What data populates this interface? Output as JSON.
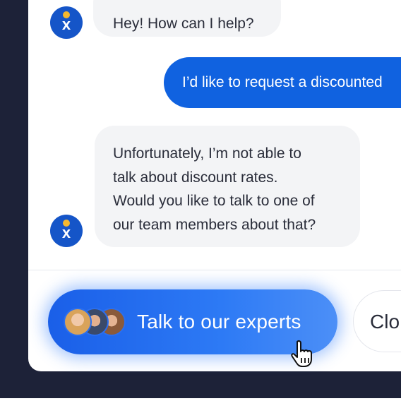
{
  "chat": {
    "messages": [
      {
        "sender": "bot",
        "text": "Hey! How can I help?"
      },
      {
        "sender": "user",
        "text": "I’d like to request a discounted"
      },
      {
        "sender": "bot",
        "lines": [
          "Unfortunately, I’m not able to",
          "talk about discount rates.",
          "Would you like to talk to one of",
          "our team members about that?"
        ]
      }
    ],
    "bot_avatar_letter": "x"
  },
  "actions": {
    "primary_label": "Talk to our experts",
    "secondary_label": "Clo"
  },
  "icons": {
    "bot_avatar": "company-logo-icon",
    "cursor": "hand-pointer-icon",
    "expert_avatars": [
      "expert-avatar-1",
      "expert-avatar-2",
      "expert-avatar-3"
    ]
  },
  "colors": {
    "dark_frame": "#1d2238",
    "primary_blue": "#1062e0",
    "bot_bubble": "#f3f4f6",
    "logo_dot": "#f5b82e"
  }
}
